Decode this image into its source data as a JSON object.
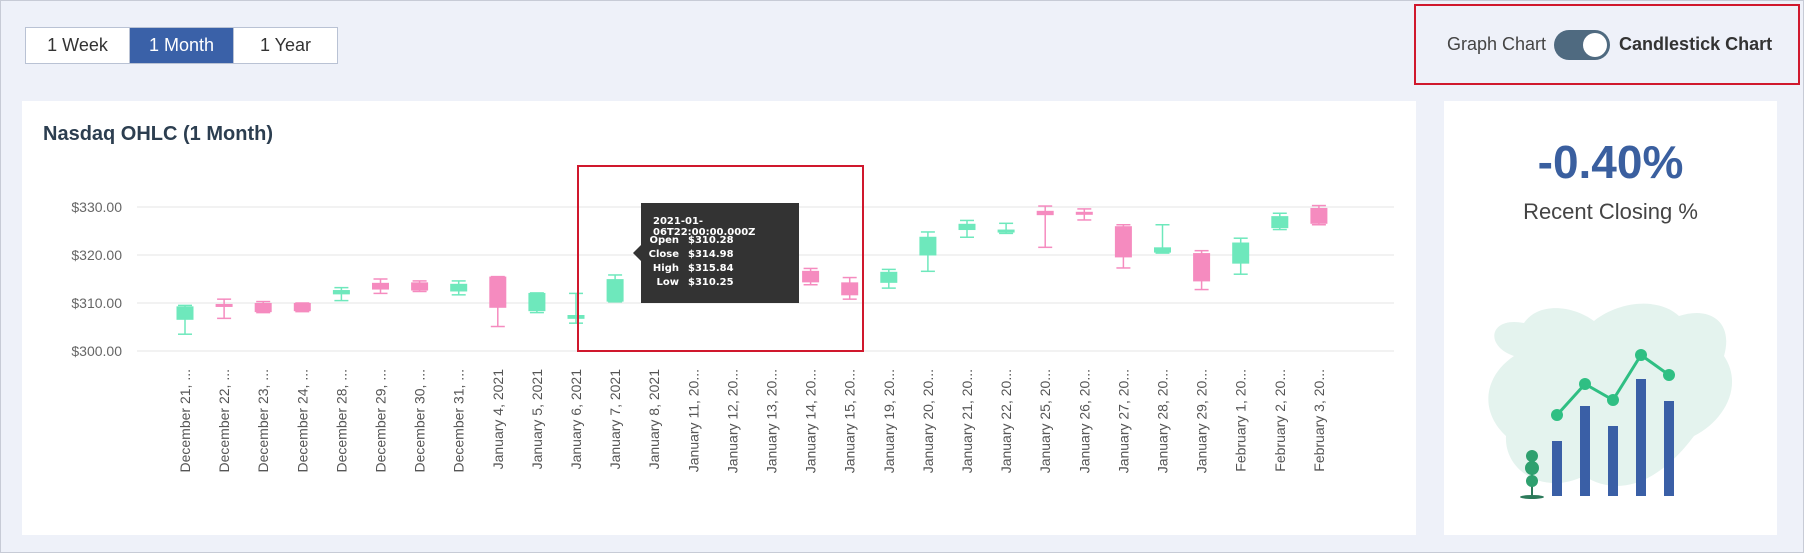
{
  "range_tabs": [
    {
      "label": "1 Week",
      "active": false
    },
    {
      "label": "1 Month",
      "active": true
    },
    {
      "label": "1 Year",
      "active": false
    }
  ],
  "toggle": {
    "left_label": "Graph Chart",
    "right_label": "Candlestick Chart",
    "state": "candlestick"
  },
  "chart": {
    "title": "Nasdaq OHLC (1 Month)",
    "tooltip": {
      "title": "2021-01-06T22:00:00.000Z",
      "rows": [
        {
          "key": "Open",
          "value": "$310.28"
        },
        {
          "key": "Close",
          "value": "$314.98"
        },
        {
          "key": "High",
          "value": "$315.84"
        },
        {
          "key": "Low",
          "value": "$310.25"
        }
      ]
    }
  },
  "stat": {
    "value": "-0.40%",
    "label": "Recent Closing %"
  },
  "colors": {
    "up": "#6ee8bc",
    "down": "#f58bbf",
    "accent": "#3a61a8",
    "highlight": "#d0182d"
  },
  "chart_data": {
    "type": "candlestick",
    "title": "Nasdaq OHLC (1 Month)",
    "ylim": [
      300,
      330
    ],
    "yticks": [
      "$300.00",
      "$310.00",
      "$320.00",
      "$330.00"
    ],
    "ytick_values": [
      300,
      310,
      320,
      330
    ],
    "grid": true,
    "categories": [
      "December 21, ...",
      "December 22, ...",
      "December 23, ...",
      "December 24, ...",
      "December 28, ...",
      "December 29, ...",
      "December 30, ...",
      "December 31, ...",
      "January 4, 2021",
      "January 5, 2021",
      "January 6, 2021",
      "January 7, 2021",
      "January 8, 2021",
      "January 11, 20...",
      "January 12, 20...",
      "January 13, 20...",
      "January 14, 20...",
      "January 15, 20...",
      "January 19, 20...",
      "January 20, 20...",
      "January 21, 20...",
      "January 22, 20...",
      "January 25, 20...",
      "January 26, 20...",
      "January 27, 20...",
      "January 28, 20...",
      "January 29, 20...",
      "February 1, 20...",
      "February 2, 20...",
      "February 3, 20..."
    ],
    "ohlc": [
      {
        "o": 306.5,
        "h": 309.5,
        "l": 303.5,
        "c": 309.3
      },
      {
        "o": 309.8,
        "h": 310.8,
        "l": 306.8,
        "c": 309.6
      },
      {
        "o": 310.0,
        "h": 310.3,
        "l": 308.0,
        "c": 308.1
      },
      {
        "o": 310.0,
        "h": 310.0,
        "l": 308.2,
        "c": 308.3
      },
      {
        "o": 311.8,
        "h": 313.2,
        "l": 310.5,
        "c": 312.7
      },
      {
        "o": 314.2,
        "h": 315.0,
        "l": 312.0,
        "c": 312.8
      },
      {
        "o": 314.3,
        "h": 314.6,
        "l": 312.4,
        "c": 312.6
      },
      {
        "o": 312.4,
        "h": 314.6,
        "l": 311.7,
        "c": 314.0
      },
      {
        "o": 315.5,
        "h": 315.5,
        "l": 305.1,
        "c": 309.0
      },
      {
        "o": 308.3,
        "h": 312.1,
        "l": 308.0,
        "c": 312.1
      },
      {
        "o": 306.7,
        "h": 312.0,
        "l": 305.8,
        "c": 307.5
      },
      {
        "o": 310.28,
        "h": 315.84,
        "l": 310.25,
        "c": 314.98
      },
      null,
      null,
      null,
      null,
      {
        "o": 316.7,
        "h": 317.2,
        "l": 313.8,
        "c": 314.3
      },
      {
        "o": 314.3,
        "h": 315.3,
        "l": 310.8,
        "c": 311.6
      },
      {
        "o": 314.2,
        "h": 317.0,
        "l": 313.1,
        "c": 316.5
      },
      {
        "o": 319.9,
        "h": 324.8,
        "l": 316.6,
        "c": 323.8
      },
      {
        "o": 325.2,
        "h": 327.2,
        "l": 323.7,
        "c": 326.5
      },
      {
        "o": 325.0,
        "h": 326.6,
        "l": 324.5,
        "c": 325.3
      },
      {
        "o": 329.2,
        "h": 330.2,
        "l": 321.6,
        "c": 328.3
      },
      {
        "o": 329.0,
        "h": 329.6,
        "l": 327.3,
        "c": 328.5
      },
      {
        "o": 326.0,
        "h": 326.3,
        "l": 317.3,
        "c": 319.5
      },
      {
        "o": 320.5,
        "h": 326.3,
        "l": 320.4,
        "c": 321.6
      },
      {
        "o": 320.4,
        "h": 320.9,
        "l": 312.8,
        "c": 314.5
      },
      {
        "o": 318.2,
        "h": 323.5,
        "l": 316.0,
        "c": 322.6
      },
      {
        "o": 325.6,
        "h": 328.7,
        "l": 325.3,
        "c": 328.1
      },
      {
        "o": 329.8,
        "h": 330.3,
        "l": 326.3,
        "c": 326.5
      }
    ]
  }
}
